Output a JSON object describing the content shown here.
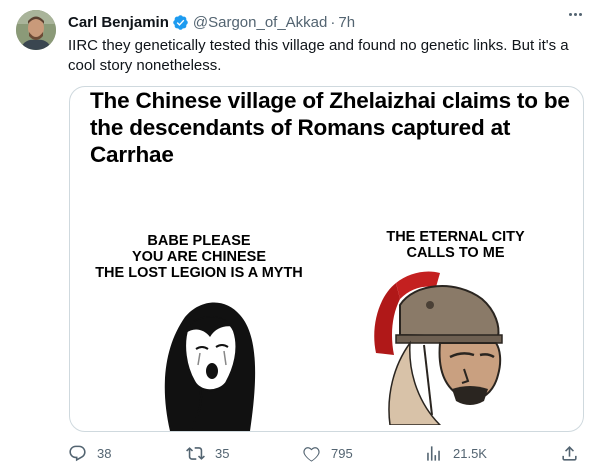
{
  "author": {
    "name": "Carl Benjamin",
    "handle": "@Sargon_of_Akkad",
    "separator": "·",
    "time": "7h"
  },
  "tweet": {
    "text": "IIRC they genetically tested this village and found no genetic links. But it's a cool story nonetheless."
  },
  "media": {
    "title": "The Chinese village of Zhelaizhai claims to be the descendants of Romans captured at Carrhae",
    "left_caption": [
      "BABE PLEASE",
      "YOU ARE CHINESE",
      "THE LOST LEGION IS A MYTH"
    ],
    "right_caption": [
      "THE ETERNAL CITY",
      "CALLS TO ME"
    ]
  },
  "actions": {
    "replies": "38",
    "retweets": "35",
    "likes": "795",
    "views": "21.5K"
  },
  "colors": {
    "verified": "#1d9bf0",
    "secondary_text": "#536471",
    "border": "#cfd9de",
    "helmet_crest": "#b01818"
  }
}
